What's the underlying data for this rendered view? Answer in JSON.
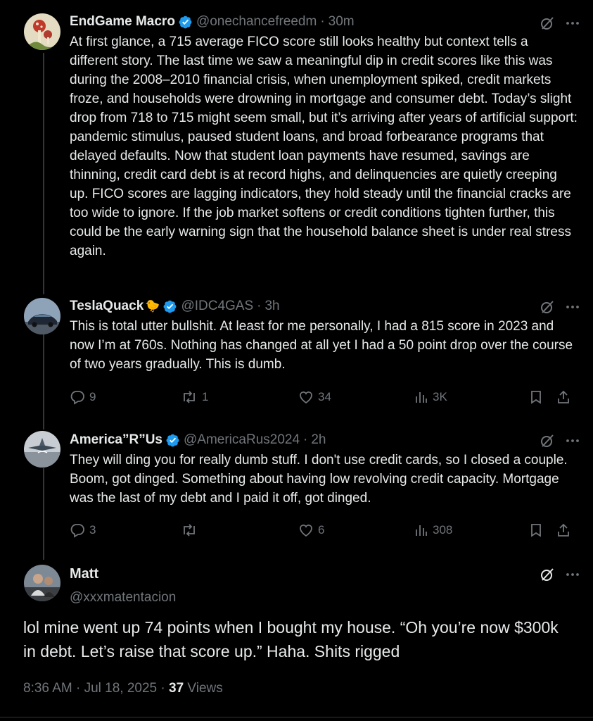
{
  "tweets": [
    {
      "name": "EndGame Macro",
      "handle": "@onechancefreedm",
      "time": "30m",
      "text": "At first glance, a 715 average FICO score still looks healthy but context tells a different story. The last time we saw a meaningful dip in credit scores like this was during the 2008–2010 financial crisis, when unemployment spiked, credit markets froze, and households were drowning in mortgage and consumer debt. Today’s slight drop from 718 to 715 might seem small, but it’s arriving after years of artificial support: pandemic stimulus, paused student loans, and broad forbearance programs that delayed defaults. Now that student loan payments have resumed, savings are thinning, credit card debt is at record highs, and delinquencies are quietly creeping up. FICO scores are lagging indicators, they hold steady until the financial cracks are too wide to ignore. If the job market softens or credit conditions tighten further, this could be the early warning sign that the household balance sheet is under real stress again."
    },
    {
      "name": "TeslaQuack",
      "emoji": "🐤",
      "handle": "@IDC4GAS",
      "time": "3h",
      "text": "This is total utter bullshit. At least for me personally, I had a 815 score in 2023 and now I’m at 760s. Nothing has changed at all yet I had a 50 point drop over the course of two years gradually. This is dumb.",
      "replies": "9",
      "reposts": "1",
      "likes": "34",
      "views": "3K"
    },
    {
      "name": "America”R”Us",
      "handle": "@AmericaRus2024",
      "time": "2h",
      "text": "They will ding you for really dumb stuff. I don't use credit cards, so I closed a couple. Boom, got dinged. Something about having low revolving credit capacity. Mortgage was the last of my debt and I paid it off, got dinged.",
      "replies": "3",
      "reposts": "",
      "likes": "6",
      "views": "308"
    }
  ],
  "main": {
    "name": "Matt",
    "handle": "@xxxmatentacion",
    "text": "lol mine went up 74 points when I bought my house. “Oh you’re now $300k in debt. Let’s raise that score up.” Haha. Shits rigged",
    "meta_time": "8:36 AM · Jul 18, 2025 · ",
    "meta_views_count": "37",
    "meta_views_label": " Views"
  },
  "colors": {
    "background": "#000000",
    "text": "#e7e9ea",
    "muted": "#71767b",
    "verified": "#1d9bf0"
  },
  "icons": [
    "verified-badge-icon",
    "grok-icon",
    "more-icon",
    "reply-icon",
    "repost-icon",
    "like-icon",
    "views-icon",
    "bookmark-icon",
    "share-icon"
  ]
}
